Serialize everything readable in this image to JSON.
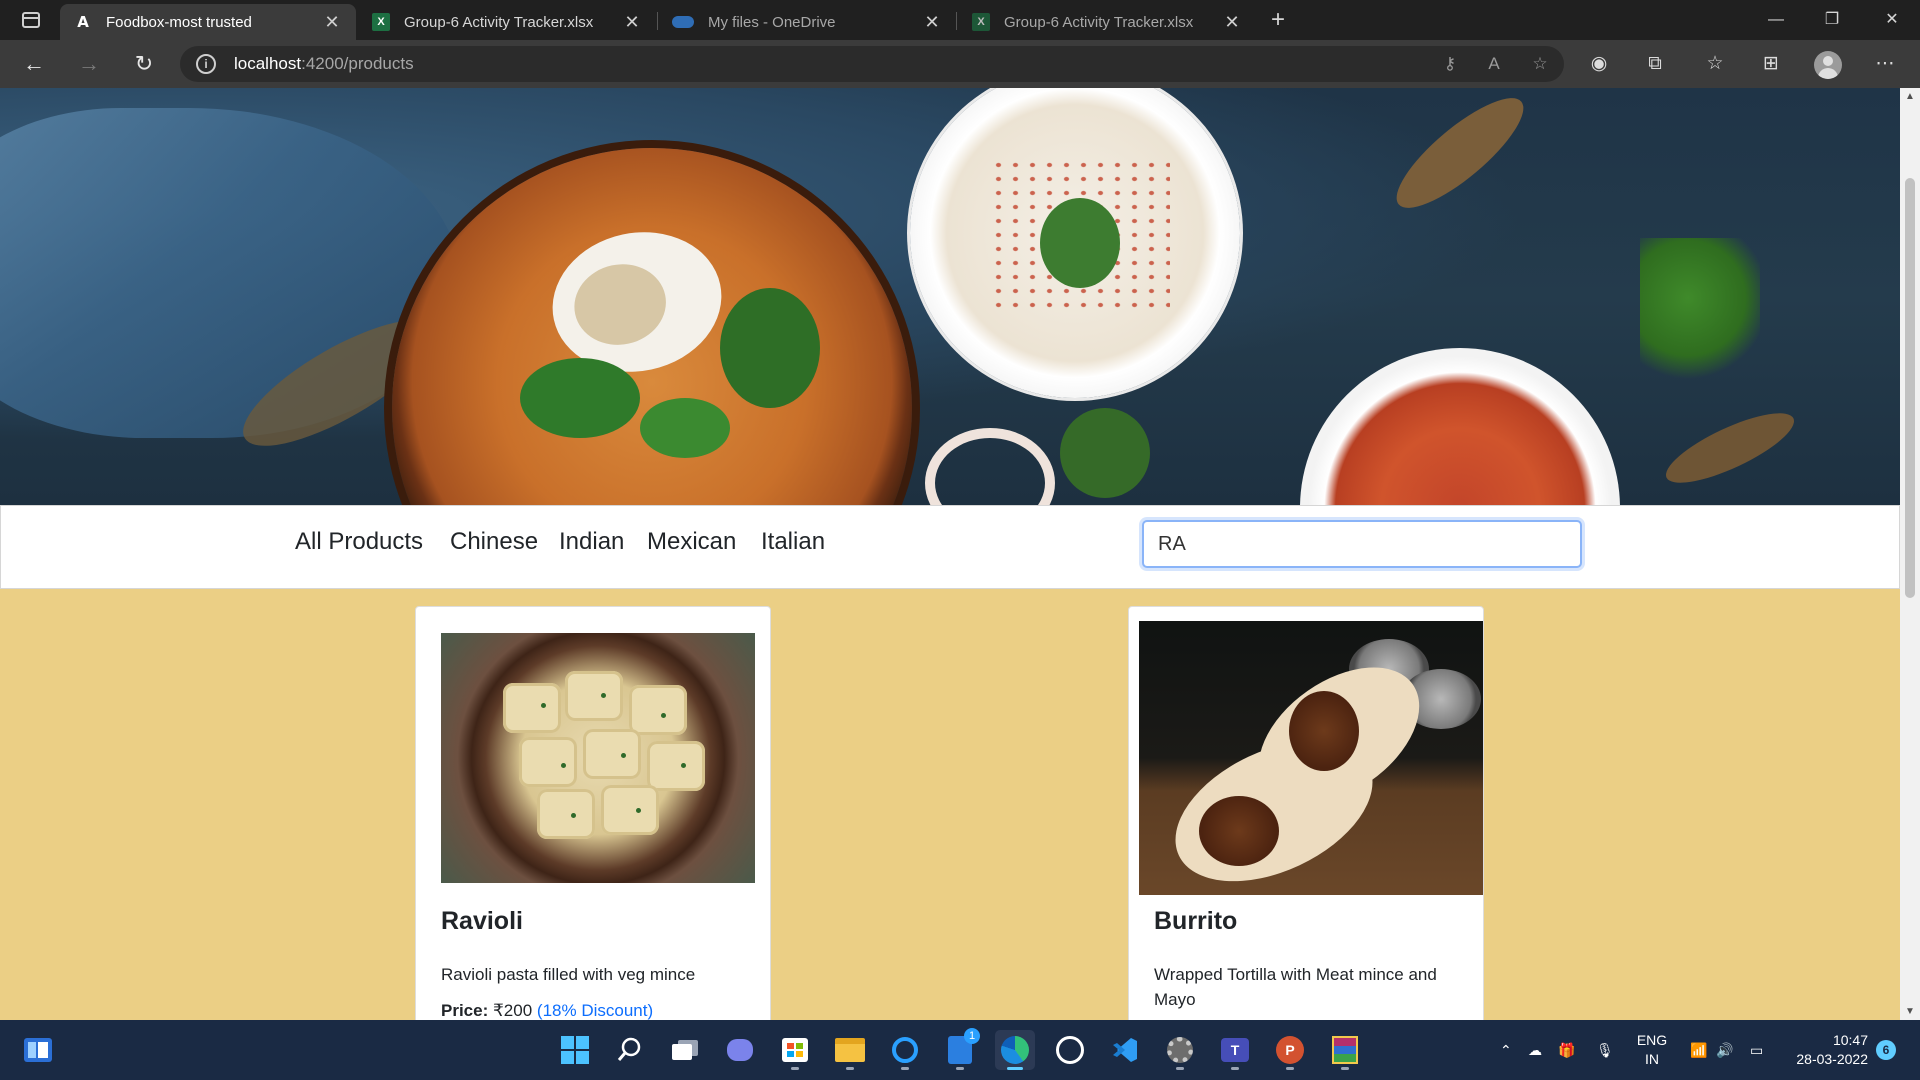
{
  "browser": {
    "tabs": [
      {
        "title": "Foodbox-most trusted",
        "icon": "angular-icon",
        "active": true
      },
      {
        "title": "Group-6 Activity Tracker.xlsx",
        "icon": "excel-icon",
        "active": false
      },
      {
        "title": "My files - OneDrive",
        "icon": "onedrive-icon",
        "active": false
      },
      {
        "title": "Group-6 Activity Tracker.xlsx",
        "icon": "excel-icon",
        "active": false
      }
    ],
    "address": {
      "host": "localhost",
      "path": ":4200/products"
    }
  },
  "page": {
    "categories": [
      "All Products",
      "Chinese",
      "Indian",
      "Mexican",
      "Italian"
    ],
    "search": {
      "value": "RA"
    },
    "products": [
      {
        "name": "Ravioli",
        "description": "Ravioli pasta filled with veg mince",
        "price_label": "Price:",
        "price": "₹200",
        "discount": "(18% Discount)"
      },
      {
        "name": "Burrito",
        "description": "Wrapped Tortilla with Meat mince and Mayo"
      }
    ]
  },
  "taskbar": {
    "apps": [
      "start",
      "search",
      "task-view",
      "teams",
      "store",
      "file-explorer",
      "cortana",
      "to-do",
      "edge",
      "github",
      "vscode",
      "settings",
      "teams-work",
      "powerpoint",
      "winrar"
    ],
    "todo_badge": "1",
    "language": {
      "line1": "ENG",
      "line2": "IN"
    },
    "time": "10:47",
    "date": "28-03-2022",
    "notifications": "6"
  },
  "colors": {
    "page_background": "#ebcf85",
    "link": "#0d6efd",
    "taskbar": "#1a2a44",
    "accent": "#60cdff"
  }
}
